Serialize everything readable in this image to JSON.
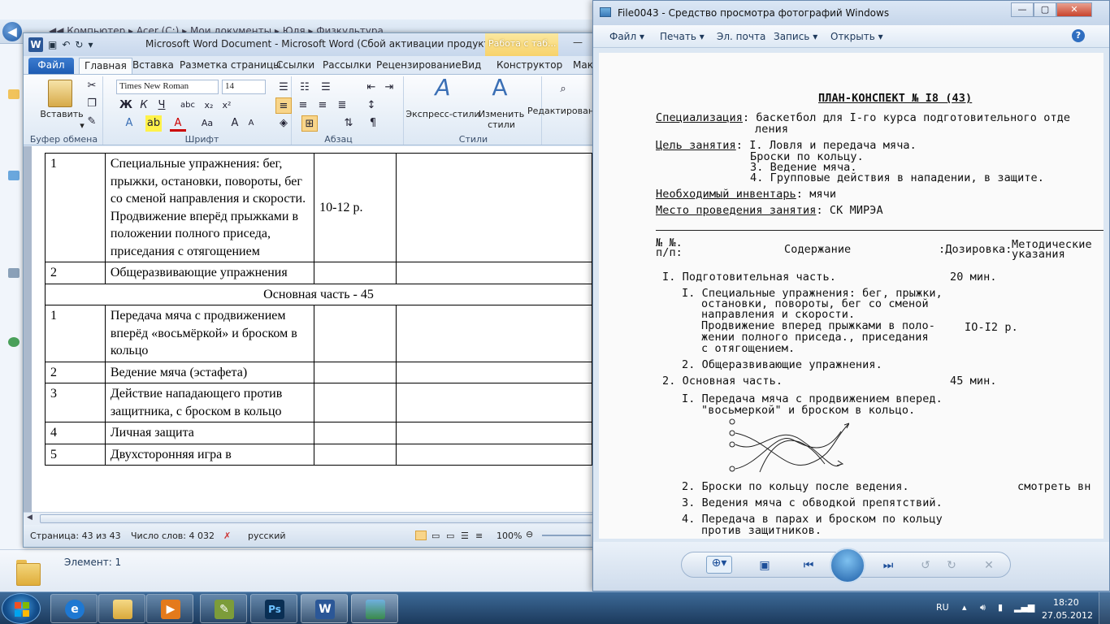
{
  "explorer": {
    "breadcrumb": "◀◀ Компьютер ▸ Acer (C:) ▸ Мои документы ▸ Юля ▸ Физкультура",
    "item_count": "Элемент: 1"
  },
  "word": {
    "title": "Microsoft Word Document  -  Microsoft Word (Сбой активации продукта)",
    "context_tab": "Работа с таб...",
    "tabs": [
      "Файл",
      "Главная",
      "Вставка",
      "Разметка страницы",
      "Ссылки",
      "Рассылки",
      "Рецензирование",
      "Вид",
      "Конструктор",
      "Маке"
    ],
    "ribbon": {
      "paste": "Вставить",
      "clipboard_group": "Буфер обмена",
      "font_name": "Times New Roman",
      "font_size": "14",
      "font_group": "Шрифт",
      "paragraph_group": "Абзац",
      "quick_styles": "Экспресс-стили",
      "change_styles": "Изменить стили",
      "styles_group": "Стили",
      "editing": "Редактирование"
    },
    "table_rows": [
      {
        "n": "1",
        "content": "Специальные упражнения: бег, прыжки, остановки, повороты, бег со сменой направления и скорости.",
        "content2": "Продвижение вперёд прыжками в положении полного приседа, приседания с отягощением",
        "dose": "10-12 р.",
        "notes": ""
      },
      {
        "n": "2",
        "content": "Общеразвивающие упражнения",
        "dose": "",
        "notes": ""
      },
      {
        "section": "Основная часть - 45"
      },
      {
        "n": "1",
        "content": "Передача мяча с продвижением вперёд «восьмёркой» и броском в кольцо",
        "dose": "",
        "notes": ""
      },
      {
        "n": "2",
        "content": "Ведение мяча (эстафета)",
        "dose": "",
        "notes": ""
      },
      {
        "n": "3",
        "content": "Действие нападающего против защитника, с броском в кольцо",
        "dose": "",
        "notes": ""
      },
      {
        "n": "4",
        "content": "Личная защита",
        "dose": "",
        "notes": ""
      },
      {
        "n": "5",
        "content": "Двухсторонняя игра в",
        "dose": "",
        "notes": ""
      }
    ],
    "status": {
      "page": "Страница: 43 из 43",
      "words": "Число слов: 4 032",
      "language": "русский",
      "zoom": "100%"
    }
  },
  "viewer": {
    "title": "File0043 - Средство просмотра фотографий Windows",
    "menu": [
      "Файл",
      "Печать",
      "Эл. почта",
      "Запись",
      "Открыть"
    ],
    "scan": {
      "heading": "ПЛАН-КОНСПЕКТ № I8  (43)",
      "spec_label": "Специализация",
      "spec_value": ": баскетбол для  I-го  курса  подготовительного отде",
      "spec_value2": "ления",
      "goal_label": "Цель занятия",
      "goals": [
        ": I. Ловля и передача мяча.",
        "Броски по кольцу.",
        "3. Ведение мяча.",
        "4. Групповые действия в нападении, в защите."
      ],
      "inventory_label": "Необходимый инвентарь",
      "inventory_value": ": мячи",
      "place_label": "Место проведения занятия",
      "place_value": ": СК МИРЭА",
      "col_num": "№ №.",
      "col_num2": "п/п:",
      "col_content": "Содержание",
      "col_dose": ":Дозировка:",
      "col_notes": "Методические",
      "col_notes2": "указания",
      "lines": [
        {
          "text": "I. Подготовительная часть.",
          "dose": "20 мин."
        },
        {
          "text": "I. Специальные упражнения: бег, прыжки,",
          "dose": ""
        },
        {
          "text": "остановки, повороты, бег со сменой",
          "dose": ""
        },
        {
          "text": "направления и скорости.",
          "dose": ""
        },
        {
          "text": "Продвижение вперед прыжками в поло-",
          "dose": "IO-I2 р."
        },
        {
          "text": "жении полного приседа., приседания",
          "dose": ""
        },
        {
          "text": "с отягощением.",
          "dose": ""
        },
        {
          "text": "2. Общеразвивающие упражнения.",
          "dose": ""
        },
        {
          "text": "2. Основная часть.",
          "dose": "45 мин."
        },
        {
          "text": "I. Передача мяча с продвижением вперед.",
          "dose": ""
        },
        {
          "text": "\"восьмеркой\" и броском в кольцо.",
          "dose": ""
        },
        {
          "text": "2. Броски по кольцу после ведения.",
          "dose": "смотреть вн"
        },
        {
          "text": "3. Ведения мяча с обводкой препятствий.",
          "dose": ""
        },
        {
          "text": "4. Передача в парах и броском по кольцу",
          "dose": ""
        },
        {
          "text": "против защитников.",
          "dose": ""
        }
      ]
    }
  },
  "taskbar": {
    "language": "RU",
    "time": "18:20",
    "date": "27.05.2012"
  }
}
